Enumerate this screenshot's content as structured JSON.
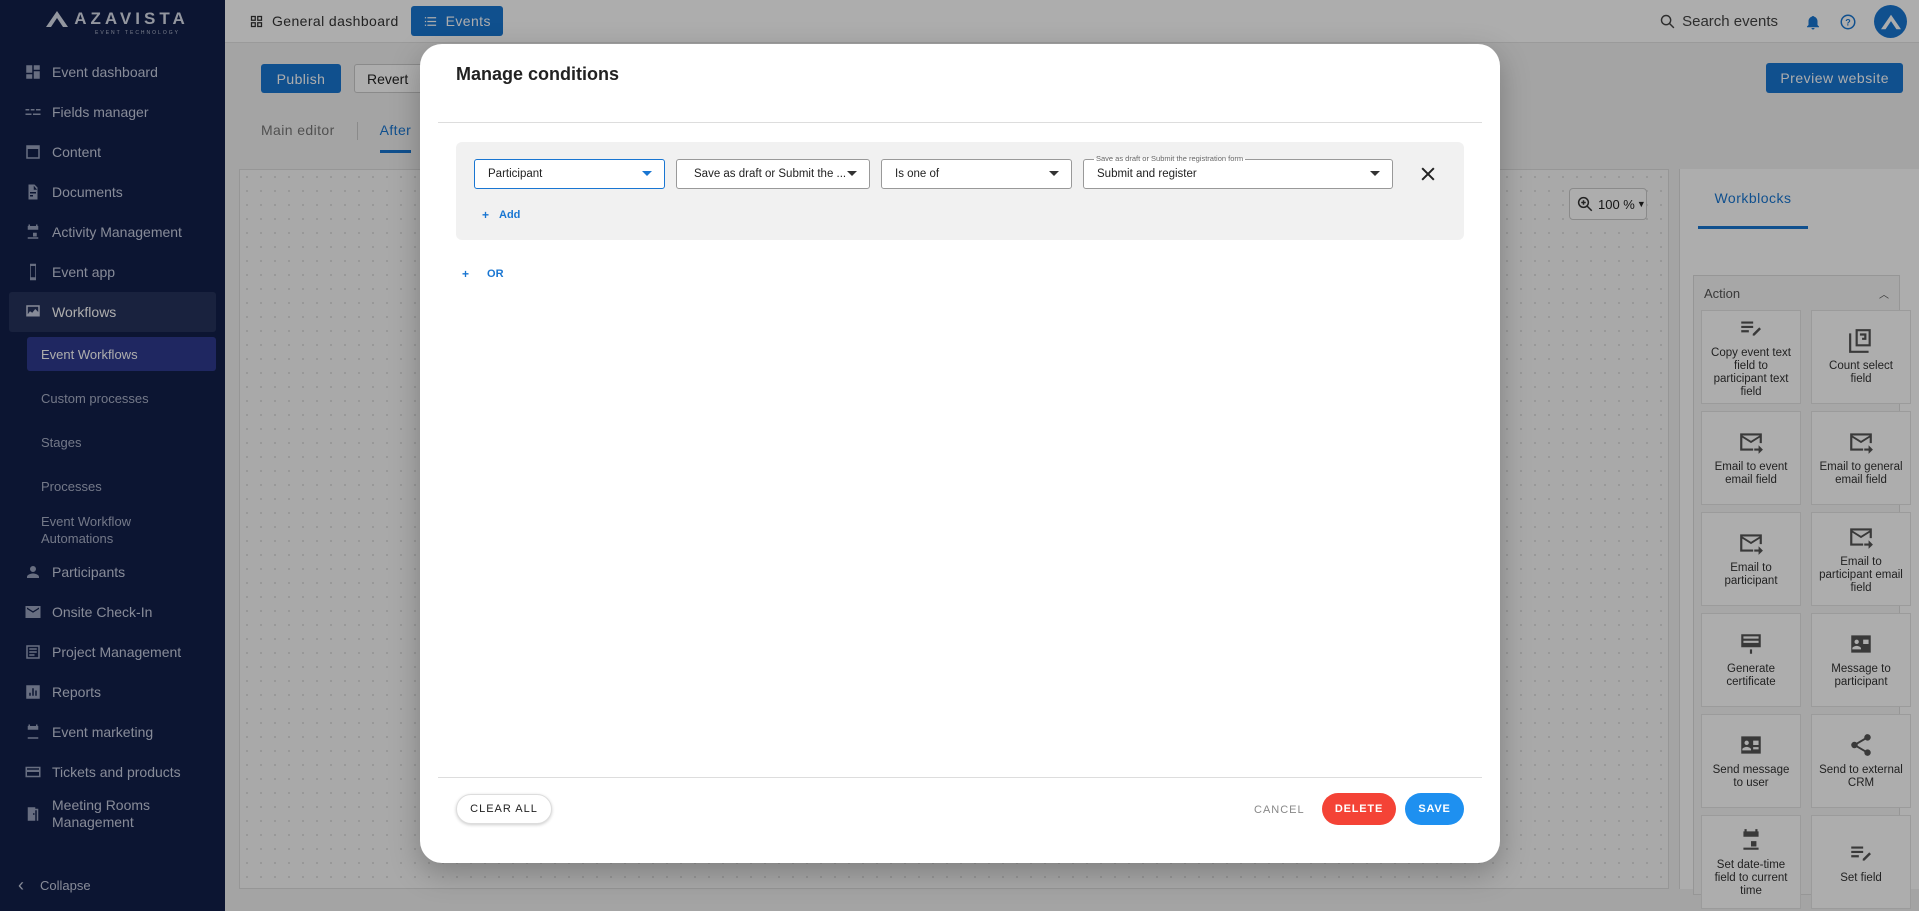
{
  "brand": {
    "name": "AZAVISTA",
    "tagline": "EVENT TECHNOLOGY"
  },
  "sidebar": {
    "items": [
      {
        "label": "Event dashboard",
        "icon": "dashboard-icon"
      },
      {
        "label": "Fields manager",
        "icon": "fields-icon"
      },
      {
        "label": "Content",
        "icon": "content-icon"
      },
      {
        "label": "Documents",
        "icon": "document-icon"
      },
      {
        "label": "Activity Management",
        "icon": "calendar-icon"
      },
      {
        "label": "Event app",
        "icon": "phone-icon"
      },
      {
        "label": "Workflows",
        "icon": "workflow-icon"
      }
    ],
    "sub_items": [
      {
        "label": "Event Workflows"
      },
      {
        "label": "Custom processes"
      },
      {
        "label": "Stages"
      },
      {
        "label": "Processes"
      },
      {
        "label": "Event Workflow Automations"
      }
    ],
    "items_after": [
      {
        "label": "Participants",
        "icon": "person-icon"
      },
      {
        "label": "Onsite Check-In",
        "icon": "mail-icon"
      },
      {
        "label": "Project Management",
        "icon": "project-icon"
      },
      {
        "label": "Reports",
        "icon": "reports-icon"
      },
      {
        "label": "Event marketing",
        "icon": "calendar-icon"
      },
      {
        "label": "Tickets and products",
        "icon": "ticket-icon"
      },
      {
        "label": "Meeting Rooms Management",
        "icon": "room-icon"
      }
    ],
    "collapse_label": "Collapse"
  },
  "topbar": {
    "general_dashboard": "General dashboard",
    "events": "Events",
    "search_placeholder": "Search events"
  },
  "toolbar": {
    "publish": "Publish",
    "revert": "Revert",
    "preview": "Preview website"
  },
  "editor_tabs": {
    "main": "Main editor",
    "after": "After"
  },
  "zoom": {
    "level": "100 %"
  },
  "panel": {
    "tab": "Workblocks",
    "group": "Action",
    "blocks": [
      {
        "label": "Copy event text field to participant text field",
        "icon": "edit-note-icon"
      },
      {
        "label": "Count select field",
        "icon": "counter-icon"
      },
      {
        "label": "Email to event email field",
        "icon": "email-forward-icon"
      },
      {
        "label": "Email to general email field",
        "icon": "email-forward-icon"
      },
      {
        "label": "Email to participant",
        "icon": "email-forward-icon"
      },
      {
        "label": "Email to participant email field",
        "icon": "email-forward-icon"
      },
      {
        "label": "Generate certificate",
        "icon": "certificate-icon"
      },
      {
        "label": "Message to participant",
        "icon": "contact-mail-icon"
      },
      {
        "label": "Send message to user",
        "icon": "contact-card-icon"
      },
      {
        "label": "Send to external CRM",
        "icon": "share-icon"
      },
      {
        "label": "Set date-time field to current time",
        "icon": "calendar-icon"
      },
      {
        "label": "Set field",
        "icon": "edit-note-icon"
      }
    ]
  },
  "modal": {
    "title": "Manage conditions",
    "condition": {
      "entity": "Participant",
      "field": "Save as draft or Submit the ...",
      "operator": "Is one of",
      "value_label": "Save as draft or Submit the registration form",
      "value": "Submit and register"
    },
    "add_label": "Add",
    "or_label": "OR",
    "clear_all": "CLEAR ALL",
    "cancel": "CANCEL",
    "delete": "DELETE",
    "save": "SAVE"
  }
}
